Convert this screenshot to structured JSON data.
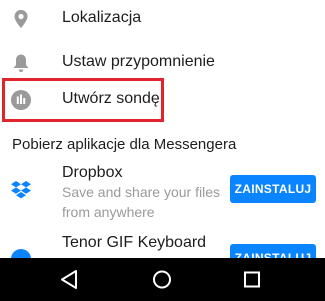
{
  "menu": {
    "items": [
      {
        "icon": "location-pin-icon",
        "label": "Lokalizacja"
      },
      {
        "icon": "bell-icon",
        "label": "Ustaw przypomnienie"
      },
      {
        "icon": "poll-icon",
        "label": "Utwórz sondę"
      }
    ]
  },
  "apps_section": {
    "title": "Pobierz aplikacje dla Messengera",
    "apps": [
      {
        "icon": "dropbox-icon",
        "name": "Dropbox",
        "description": "Save and share your files from anywhere",
        "install_label": "ZAINSTALUJ"
      },
      {
        "icon": "tenor-gif-icon",
        "name": "Tenor GIF Keyboard",
        "description": "",
        "install_label": "ZAINSTALUJ"
      }
    ]
  },
  "colors": {
    "highlight": "#e0242a",
    "install_button": "#0a84ff",
    "icon_gray": "#9a9a9a",
    "navbar": "#000000"
  },
  "navbar": {
    "buttons": [
      "back-icon",
      "home-icon",
      "recents-icon"
    ]
  }
}
